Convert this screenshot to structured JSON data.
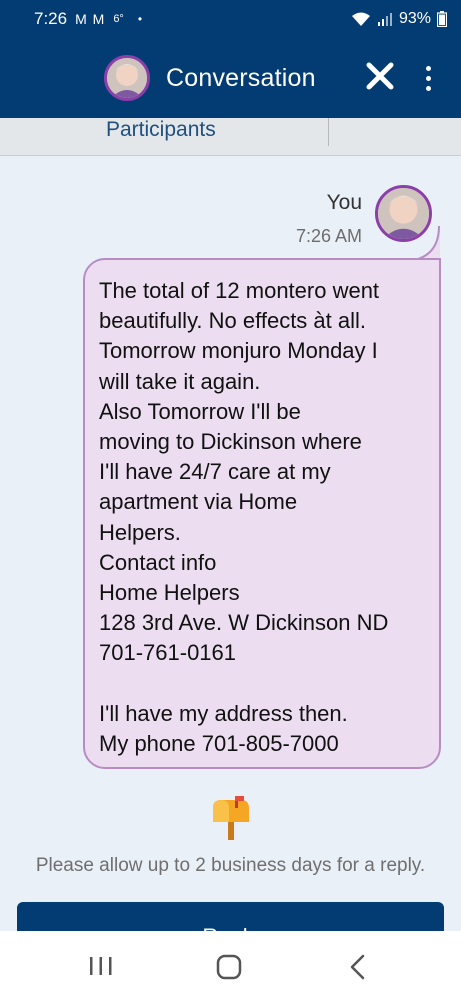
{
  "status_bar": {
    "time": "7:26",
    "notif_icons": "M M",
    "temperature": "6°",
    "dot": "•",
    "battery": "93%"
  },
  "header": {
    "title": "Conversation"
  },
  "tabs": {
    "participants": "Participants"
  },
  "message": {
    "sender": "You",
    "time": "7:26 AM",
    "lines": [
      "The total of 12 montero went",
      "beautifully. No effects àt all.",
      "Tomorrow monjuro Monday I",
      "will take it again.",
      "Also Tomorrow I'll  be",
      "moving to Dickinson where",
      "I'll have 24/7 care at my",
      "apartment via Home",
      "Helpers.",
      "Contact info",
      "Home Helpers",
      "128 3rd Ave. W Dickinson ND",
      "701-761-0161",
      "",
      "I'll have my address then.",
      "My phone 701-805-7000"
    ]
  },
  "notice": {
    "text": "Please allow up to 2 business days for a reply."
  },
  "reply_button": {
    "label": "Reply"
  },
  "colors": {
    "header_bg": "#033c73",
    "bubble_bg": "#ecdef0",
    "bubble_border": "#b78cc4",
    "avatar_ring": "#8b3fa8"
  },
  "icons": [
    "wifi-icon",
    "signal-icon",
    "battery-icon",
    "close-icon",
    "more-vert-icon",
    "mailbox-icon",
    "nav-recents-icon",
    "nav-home-icon",
    "nav-back-icon"
  ]
}
